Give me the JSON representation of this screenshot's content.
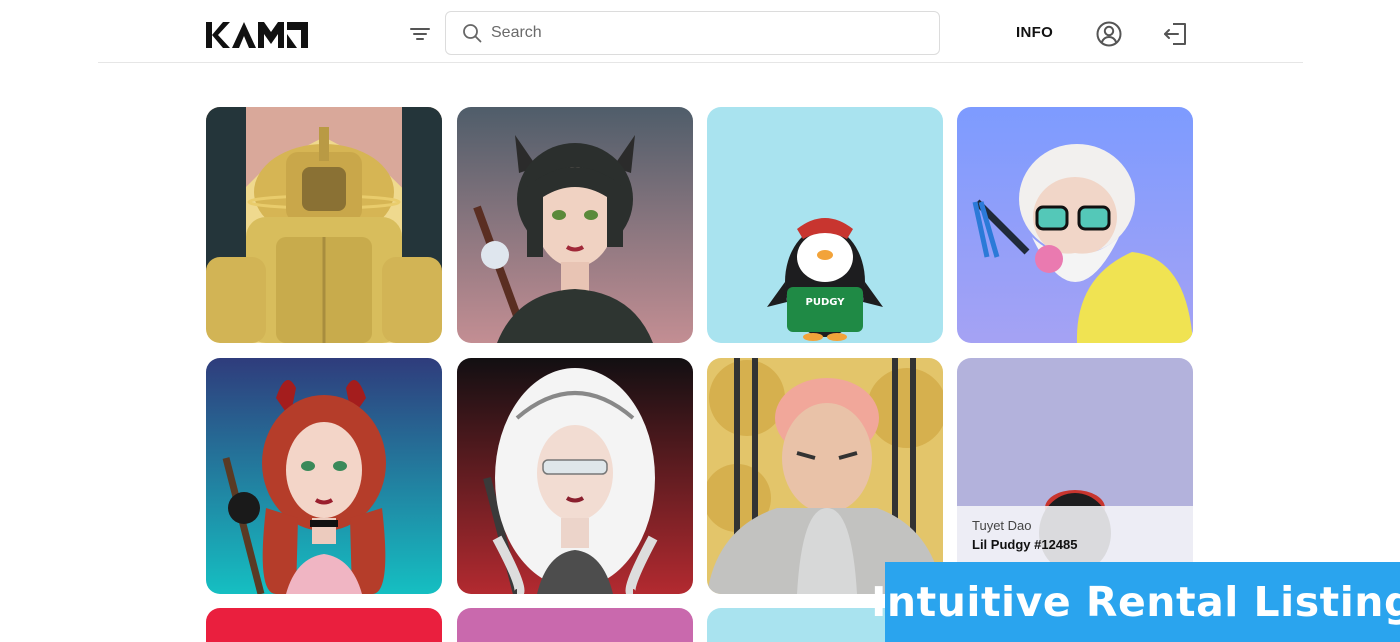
{
  "header": {
    "brand_name": "KAMI",
    "search_placeholder": "Search",
    "search_value": "",
    "info_label": "INFO",
    "icons": {
      "filter": "filter-icon",
      "search": "search-icon",
      "user": "user-circle-icon",
      "logout": "logout-icon"
    }
  },
  "grid": {
    "hovered_item": {
      "owner": "Tuyet Dao",
      "name": "Lil Pudgy #12485"
    },
    "tile_colors": [
      "#efd98e",
      "#5b6a78",
      "#a9e3ef",
      "#7d9bff",
      "#2f3c7c",
      "#1a1416",
      "#e3c56a",
      "#b3b2dc",
      "#ea1f3e",
      "#c969ad",
      "#a9e3ef"
    ]
  },
  "banner": {
    "text": "Intuitive Rental Listing",
    "color": "#2aa4ee"
  }
}
